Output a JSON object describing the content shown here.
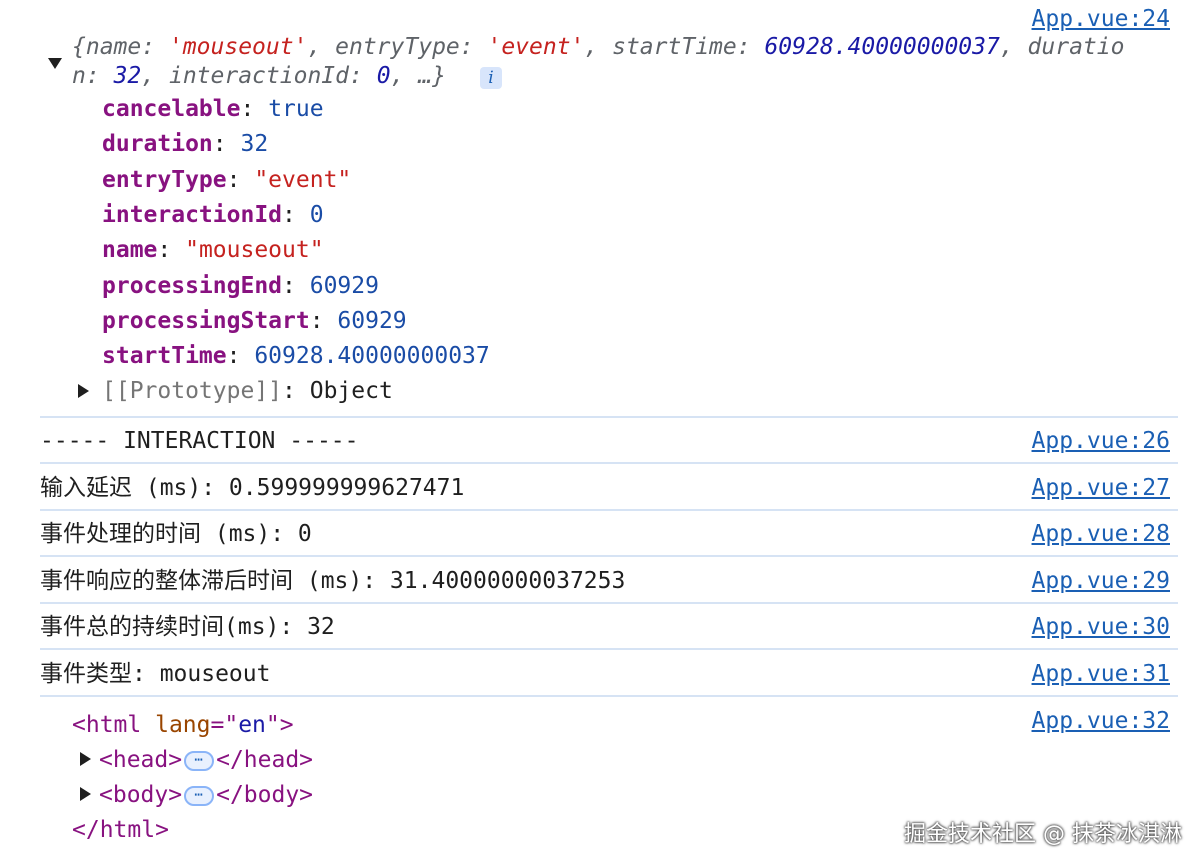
{
  "object_log": {
    "source": "App.vue:24",
    "preview_line1": {
      "open": "{",
      "k1": "name",
      "v1": "'mouseout'",
      "k2": "entryType",
      "v2": "'event'",
      "k3": "startTime",
      "v3": "60928.40000000037",
      "k4a": "duratio"
    },
    "preview_line2": {
      "k4b": "n",
      "v4": "32",
      "k5": "interactionId",
      "v5": "0",
      "tail": ", …}"
    },
    "info_badge": "i",
    "properties": [
      {
        "key": "cancelable",
        "value": "true",
        "type": "bool"
      },
      {
        "key": "duration",
        "value": "32",
        "type": "number"
      },
      {
        "key": "entryType",
        "value": "\"event\"",
        "type": "string"
      },
      {
        "key": "interactionId",
        "value": "0",
        "type": "number"
      },
      {
        "key": "name",
        "value": "\"mouseout\"",
        "type": "string"
      },
      {
        "key": "processingEnd",
        "value": "60929",
        "type": "number"
      },
      {
        "key": "processingStart",
        "value": "60929",
        "type": "number"
      },
      {
        "key": "startTime",
        "value": "60928.40000000037",
        "type": "number"
      }
    ],
    "prototype": {
      "key": "[[Prototype]]",
      "value": "Object"
    }
  },
  "logs": [
    {
      "text": "----- INTERACTION -----",
      "source": "App.vue:26"
    },
    {
      "text": "输入延迟 (ms): 0.599999999627471",
      "source": "App.vue:27"
    },
    {
      "text": "事件处理的时间 (ms): 0",
      "source": "App.vue:28"
    },
    {
      "text": "事件响应的整体滞后时间 (ms): 31.40000000037253",
      "source": "App.vue:29"
    },
    {
      "text": "事件总的持续时间(ms): 32",
      "source": "App.vue:30"
    },
    {
      "text": "事件类型: mouseout",
      "source": "App.vue:31"
    }
  ],
  "dom_log": {
    "source": "App.vue:32",
    "html_open": "<html",
    "attr_name": "lang",
    "attr_eq": "=\"",
    "attr_value": "en",
    "attr_close": "\">",
    "head_open": "<head>",
    "head_close": "</head>",
    "body_open": "<body>",
    "body_close": "</body>",
    "html_close": "</html>",
    "ellipsis": "⋯"
  },
  "watermark": "掘金技术社区 @ 抹茶冰淇淋"
}
